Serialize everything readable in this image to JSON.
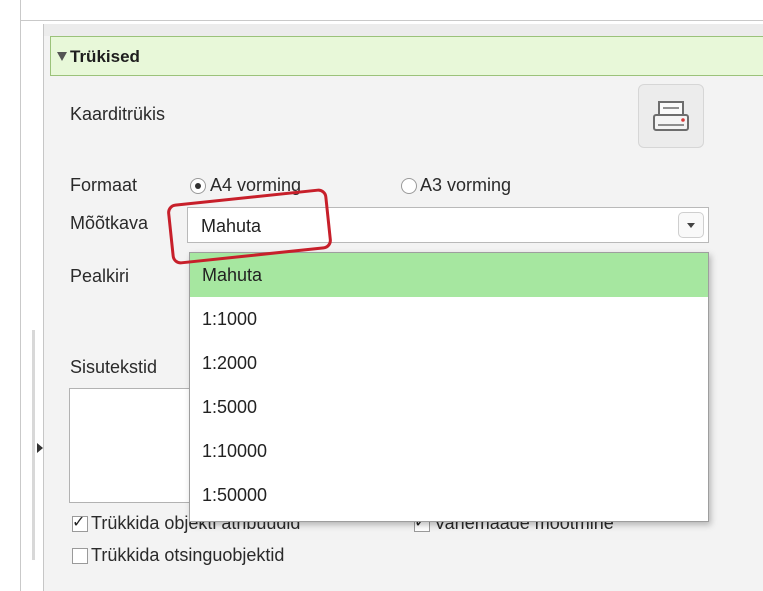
{
  "section": {
    "title": "Trükised"
  },
  "print": {
    "map_print_label": "Kaarditrükis",
    "format_label": "Formaat",
    "format_options": [
      "A4 vorming",
      "A3 vorming"
    ],
    "format_selected": "A4 vorming",
    "scale_label": "Mõõtkava",
    "scale_value": "Mahuta",
    "scale_options": [
      "Mahuta",
      "1:1000",
      "1:2000",
      "1:5000",
      "1:10000",
      "1:50000"
    ],
    "title_label": "Pealkiri",
    "content_label": "Sisutekstid",
    "checkbox1_label": "Trükkida objekti atribuudid",
    "checkbox1_checked": true,
    "checkbox2_label": "Vahemaade mõõtmine",
    "checkbox2_checked": true,
    "checkbox3_label": "Trükkida otsinguobjektid",
    "checkbox3_checked": false
  },
  "icons": {
    "printer": "printer-icon",
    "collapse": "triangle-down-icon"
  },
  "colors": {
    "header_bg": "#e8f8d9",
    "selected_option": "#a6e7a0",
    "annotation": "#c71f2a"
  }
}
